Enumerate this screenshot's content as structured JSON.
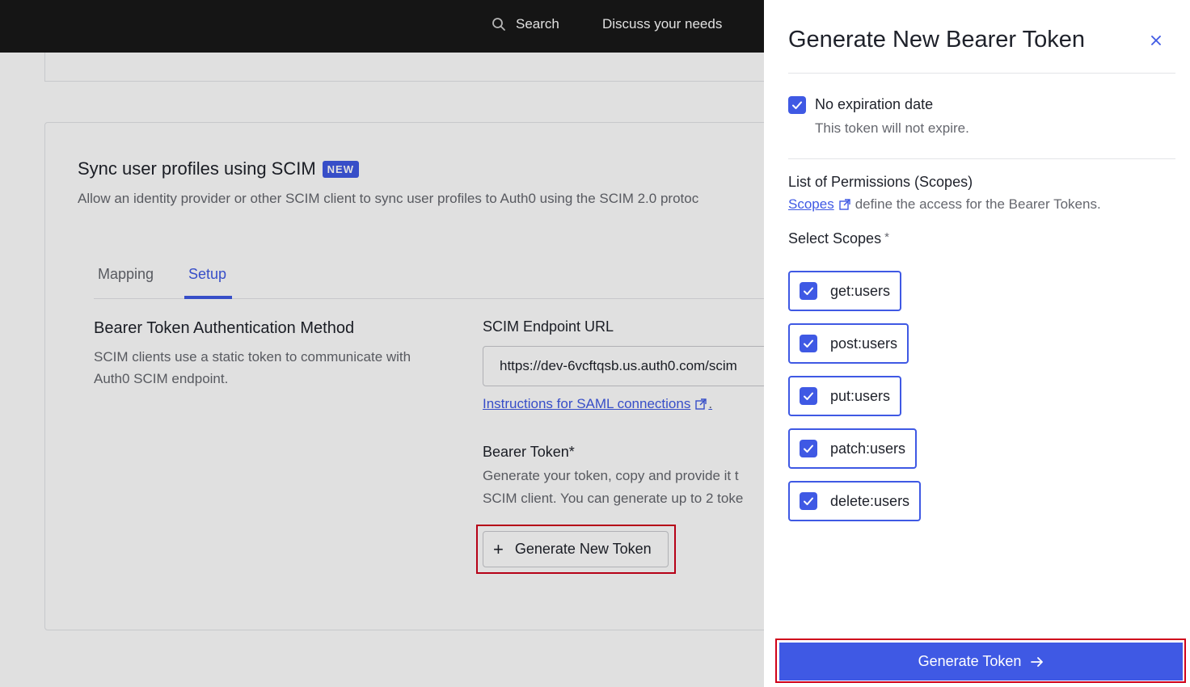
{
  "topbar": {
    "search_label": "Search",
    "discuss_label": "Discuss your needs"
  },
  "scim": {
    "title": "Sync user profiles using SCIM",
    "badge": "NEW",
    "description": "Allow an identity provider or other SCIM client to sync user profiles to Auth0 using the SCIM 2.0 protoc"
  },
  "tabs": [
    {
      "label": "Mapping"
    },
    {
      "label": "Setup"
    }
  ],
  "bearer_section": {
    "title": "Bearer Token Authentication Method",
    "description": "SCIM clients use a static token to communicate with Auth0 SCIM endpoint."
  },
  "endpoint": {
    "label": "SCIM Endpoint URL",
    "value": "https://dev-6vcftqsb.us.auth0.com/scim",
    "saml_link": "Instructions for SAML connections",
    "saml_suffix": "."
  },
  "token": {
    "label": "Bearer Token*",
    "desc_line1": "Generate your token, copy and provide it t",
    "desc_line2": "SCIM client. You can generate up to 2 toke",
    "generate_new_label": "Generate New Token"
  },
  "drawer": {
    "title": "Generate New Bearer Token",
    "no_expiration_label": "No expiration date",
    "no_expiration_desc": "This token will not expire.",
    "permissions_title": "List of Permissions (Scopes)",
    "scopes_link": "Scopes",
    "permissions_desc": "define the access for the Bearer Tokens.",
    "select_scopes_label": "Select Scopes",
    "required_mark": "*",
    "scopes": [
      {
        "label": "get:users",
        "checked": true
      },
      {
        "label": "post:users",
        "checked": true
      },
      {
        "label": "put:users",
        "checked": true
      },
      {
        "label": "patch:users",
        "checked": true
      },
      {
        "label": "delete:users",
        "checked": true
      }
    ],
    "generate_button_label": "Generate Token"
  },
  "colors": {
    "accent": "#3f59e4",
    "highlight": "#d0021b",
    "topbar": "#191919"
  }
}
